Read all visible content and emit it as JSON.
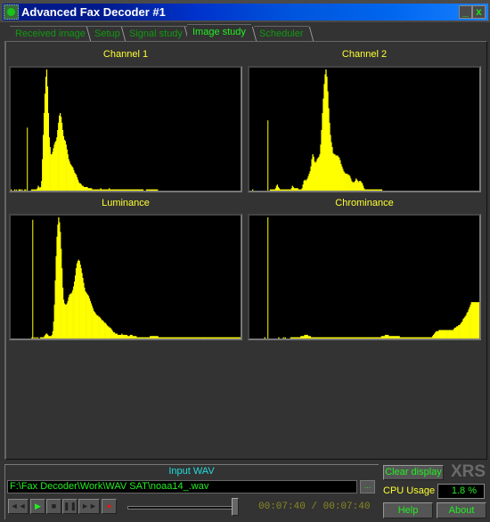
{
  "window": {
    "title": "Advanced Fax Decoder #1",
    "minimize_glyph": "_",
    "close_glyph": "x"
  },
  "tabs": [
    {
      "label": "Received image",
      "active": false
    },
    {
      "label": "Setup",
      "active": false
    },
    {
      "label": "Signal study",
      "active": false
    },
    {
      "label": "Image study",
      "active": true
    },
    {
      "label": "Scheduler",
      "active": false
    }
  ],
  "colors": {
    "histogram": "#ffff00",
    "accent_green": "#22ee22",
    "label_yellow": "#ffff33",
    "label_cyan": "#22dddd"
  },
  "chart_data": [
    {
      "type": "bar",
      "title": "Channel 1",
      "xlabel": "",
      "ylabel": "",
      "xlim": [
        0,
        255
      ],
      "ylim": [
        0,
        100
      ],
      "grid": false,
      "marker_line": {
        "x": 18,
        "value": 52
      },
      "values": [
        1,
        0,
        0,
        0,
        1,
        0,
        1,
        0,
        0,
        1,
        1,
        1,
        0,
        1,
        0,
        0,
        1,
        1,
        0,
        0,
        0,
        0,
        0,
        0,
        1,
        1,
        1,
        1,
        1,
        1,
        1,
        2,
        4,
        3,
        2,
        3,
        8,
        26,
        46,
        64,
        80,
        94,
        100,
        86,
        64,
        44,
        36,
        30,
        30,
        32,
        35,
        38,
        40,
        41,
        44,
        50,
        56,
        62,
        64,
        61,
        56,
        50,
        45,
        42,
        41,
        38,
        34,
        30,
        26,
        24,
        22,
        21,
        20,
        19,
        17,
        15,
        14,
        13,
        11,
        9,
        7,
        6,
        6,
        5,
        4,
        4,
        3,
        3,
        3,
        3,
        3,
        2,
        2,
        2,
        2,
        2,
        1,
        1,
        1,
        1,
        1,
        1,
        1,
        1,
        1,
        1,
        2,
        1,
        1,
        1,
        1,
        1,
        1,
        1,
        1,
        1,
        2,
        1,
        1,
        1,
        1,
        1,
        1,
        1,
        1,
        1,
        1,
        1,
        1,
        1,
        1,
        1,
        1,
        1,
        1,
        1,
        1,
        1,
        1,
        1,
        1,
        1,
        1,
        1,
        1,
        1,
        1,
        1,
        1,
        1,
        1,
        1,
        1,
        1,
        1,
        1,
        1,
        0,
        0,
        0,
        1,
        1,
        1,
        1,
        1,
        1,
        1,
        1,
        1,
        1,
        1,
        1,
        1,
        1,
        0,
        0,
        0,
        0,
        0,
        0,
        0,
        0,
        0,
        0,
        0,
        0,
        0,
        0,
        0,
        0,
        0,
        0,
        0,
        0,
        0,
        0,
        0,
        0,
        0,
        0,
        0,
        0,
        0,
        0,
        0,
        0,
        0,
        0,
        0,
        0,
        0,
        0,
        0,
        0,
        0,
        0,
        0,
        0,
        0,
        0,
        0,
        0,
        0,
        0,
        0,
        0,
        0,
        0,
        0,
        0,
        0,
        0,
        0,
        0,
        0,
        0,
        0,
        0,
        0,
        0,
        0,
        0,
        0,
        0,
        0,
        0,
        0,
        0,
        0,
        0,
        0,
        0,
        0,
        0,
        0,
        0,
        0,
        0,
        0,
        0,
        0,
        0,
        0,
        0,
        0,
        0,
        0,
        0,
        0,
        0,
        0,
        0
      ]
    },
    {
      "type": "bar",
      "title": "Channel 2",
      "xlabel": "",
      "ylabel": "",
      "xlim": [
        0,
        255
      ],
      "ylim": [
        0,
        100
      ],
      "grid": false,
      "marker_line": {
        "x": 20,
        "value": 58
      },
      "values": [
        0,
        0,
        0,
        1,
        0,
        0,
        0,
        0,
        0,
        0,
        0,
        0,
        0,
        0,
        0,
        0,
        0,
        0,
        0,
        0,
        0,
        0,
        0,
        1,
        1,
        1,
        1,
        1,
        1,
        2,
        4,
        5,
        3,
        2,
        1,
        1,
        1,
        1,
        1,
        1,
        1,
        1,
        1,
        1,
        1,
        1,
        1,
        2,
        4,
        3,
        2,
        2,
        2,
        2,
        2,
        1,
        1,
        1,
        1,
        2,
        5,
        8,
        9,
        8,
        9,
        10,
        12,
        14,
        16,
        20,
        26,
        30,
        28,
        24,
        23,
        24,
        26,
        27,
        28,
        30,
        38,
        50,
        64,
        76,
        88,
        96,
        100,
        94,
        82,
        68,
        56,
        46,
        40,
        36,
        31,
        30,
        30,
        29,
        29,
        29,
        28,
        27,
        25,
        22,
        20,
        18,
        16,
        15,
        14,
        14,
        14,
        13,
        13,
        12,
        10,
        8,
        7,
        7,
        7,
        8,
        10,
        9,
        8,
        7,
        8,
        8,
        7,
        6,
        4,
        2,
        1,
        1,
        1,
        1,
        1,
        1,
        1,
        1,
        1,
        1,
        1,
        1,
        1,
        1,
        1,
        1,
        1,
        1,
        1,
        1,
        0,
        0,
        0,
        0,
        0,
        0,
        0,
        0,
        0,
        0,
        0,
        0,
        0,
        0,
        0,
        0,
        0,
        0,
        0,
        0,
        0,
        0,
        0,
        0,
        0,
        0,
        0,
        0,
        0,
        0,
        0,
        0,
        0,
        0,
        0,
        0,
        0,
        0,
        0,
        0,
        0,
        0,
        0,
        0,
        0,
        0,
        0,
        0,
        0,
        0,
        0,
        0,
        0,
        0,
        0,
        0,
        0,
        0,
        0,
        0,
        0,
        0,
        0,
        0,
        0,
        0,
        0,
        0,
        0,
        0,
        0,
        0,
        0,
        0,
        0,
        0,
        0,
        0,
        0,
        0,
        0,
        0,
        0,
        0,
        0,
        0,
        0,
        0,
        0,
        0,
        0,
        0,
        0,
        0,
        0,
        0,
        0,
        0,
        0,
        0,
        0,
        0,
        0,
        0,
        0,
        0,
        0,
        0,
        0,
        0
      ]
    },
    {
      "type": "bar",
      "title": "Luminance",
      "xlabel": "",
      "ylabel": "",
      "xlim": [
        0,
        255
      ],
      "ylim": [
        0,
        100
      ],
      "grid": false,
      "marker_line": {
        "x": 24,
        "value": 98
      },
      "values": [
        0,
        0,
        0,
        0,
        0,
        0,
        0,
        0,
        0,
        0,
        0,
        0,
        0,
        0,
        0,
        0,
        0,
        0,
        0,
        0,
        0,
        0,
        0,
        0,
        0,
        1,
        1,
        0,
        1,
        0,
        1,
        0,
        1,
        0,
        0,
        1,
        1,
        1,
        1,
        1,
        2,
        3,
        4,
        4,
        3,
        2,
        2,
        2,
        2,
        3,
        6,
        14,
        28,
        48,
        68,
        84,
        94,
        100,
        96,
        88,
        74,
        58,
        42,
        32,
        29,
        28,
        28,
        29,
        31,
        34,
        36,
        37,
        37,
        38,
        40,
        43,
        47,
        52,
        58,
        62,
        64,
        65,
        64,
        61,
        58,
        54,
        50,
        46,
        42,
        39,
        38,
        37,
        36,
        35,
        33,
        31,
        29,
        27,
        25,
        23,
        22,
        21,
        20,
        19,
        19,
        18,
        18,
        17,
        16,
        15,
        15,
        14,
        13,
        13,
        12,
        11,
        10,
        10,
        9,
        9,
        8,
        7,
        6,
        5,
        5,
        4,
        4,
        4,
        3,
        3,
        3,
        3,
        3,
        4,
        3,
        3,
        3,
        3,
        3,
        3,
        2,
        2,
        2,
        3,
        3,
        3,
        2,
        2,
        2,
        2,
        2,
        1,
        1,
        1,
        1,
        1,
        1,
        1,
        1,
        1,
        1,
        1,
        1,
        1,
        1,
        1,
        1,
        2,
        2,
        2,
        2,
        2,
        2,
        2,
        2,
        2,
        2,
        1,
        1,
        1,
        1,
        1,
        1,
        1,
        1,
        1,
        1,
        1,
        1,
        1,
        1,
        1,
        1,
        1,
        1,
        1,
        1,
        1,
        1,
        1,
        1,
        1,
        1,
        1,
        1,
        1,
        1,
        1,
        1,
        1,
        1,
        1,
        1,
        1,
        1,
        1,
        1,
        1,
        1,
        1,
        1,
        1,
        1,
        1,
        1,
        1,
        1,
        1,
        1,
        1,
        1,
        1,
        1,
        1,
        1,
        1,
        1,
        1,
        1,
        1,
        1,
        1,
        1,
        1,
        1,
        1,
        1,
        1,
        1,
        1,
        1,
        1,
        1,
        1,
        1,
        1,
        1,
        1,
        1,
        1,
        1,
        1,
        1,
        1,
        1,
        1,
        1,
        1,
        1,
        1,
        1,
        1,
        1,
        1,
        1,
        1
      ]
    },
    {
      "type": "bar",
      "title": "Chrominance",
      "xlabel": "",
      "ylabel": "",
      "xlim": [
        0,
        255
      ],
      "ylim": [
        0,
        100
      ],
      "grid": false,
      "marker_line": {
        "x": 20,
        "value": 100
      },
      "values": [
        0,
        0,
        0,
        0,
        0,
        0,
        0,
        0,
        0,
        0,
        0,
        0,
        0,
        0,
        0,
        0,
        1,
        0,
        0,
        0,
        0,
        0,
        0,
        0,
        0,
        0,
        0,
        0,
        0,
        0,
        0,
        1,
        0,
        0,
        0,
        0,
        1,
        0,
        1,
        0,
        0,
        0,
        0,
        0,
        1,
        1,
        1,
        1,
        1,
        1,
        1,
        1,
        1,
        1,
        1,
        2,
        2,
        2,
        2,
        3,
        3,
        3,
        3,
        2,
        2,
        2,
        1,
        1,
        1,
        1,
        1,
        1,
        1,
        1,
        1,
        1,
        1,
        1,
        1,
        1,
        1,
        1,
        1,
        1,
        1,
        1,
        1,
        1,
        1,
        1,
        1,
        1,
        1,
        1,
        1,
        1,
        1,
        1,
        1,
        1,
        1,
        1,
        1,
        1,
        1,
        1,
        1,
        1,
        1,
        1,
        1,
        1,
        1,
        1,
        1,
        1,
        1,
        1,
        1,
        1,
        1,
        1,
        1,
        1,
        1,
        1,
        1,
        1,
        1,
        1,
        1,
        1,
        1,
        1,
        1,
        1,
        1,
        1,
        1,
        1,
        1,
        1,
        2,
        2,
        2,
        2,
        3,
        3,
        3,
        3,
        2,
        2,
        2,
        2,
        2,
        2,
        2,
        2,
        2,
        2,
        2,
        2,
        1,
        1,
        1,
        1,
        1,
        1,
        1,
        1,
        1,
        1,
        1,
        1,
        1,
        1,
        1,
        1,
        1,
        1,
        1,
        1,
        1,
        1,
        1,
        1,
        1,
        1,
        1,
        1,
        1,
        1,
        1,
        1,
        1,
        1,
        1,
        2,
        3,
        4,
        5,
        6,
        6,
        6,
        7,
        7,
        7,
        7,
        7,
        7,
        7,
        7,
        7,
        7,
        7,
        7,
        7,
        7,
        7,
        7,
        8,
        9,
        9,
        10,
        10,
        11,
        11,
        12,
        13,
        14,
        16,
        17,
        18,
        19,
        21,
        22,
        24,
        26,
        28,
        30,
        30,
        30,
        30,
        30,
        30,
        30,
        30,
        30
      ]
    }
  ],
  "input": {
    "label": "Input WAV",
    "path": "F:\\Fax Decoder\\Work\\WAV SAT\\noaa14_.wav",
    "browse_label": "...",
    "elapsed": "00:07:40",
    "separator": "/",
    "total": "00:07:40",
    "position_fraction": 1.0
  },
  "transport": [
    {
      "name": "rewind-button",
      "icon": "rewind-icon",
      "glyph": "◄◄"
    },
    {
      "name": "play-button",
      "icon": "play-icon",
      "glyph": "▶"
    },
    {
      "name": "stop-button",
      "icon": "stop-icon",
      "glyph": "■"
    },
    {
      "name": "pause-button",
      "icon": "pause-icon",
      "glyph": "❚❚"
    },
    {
      "name": "fast-forward-button",
      "icon": "fast-forward-icon",
      "glyph": "►►"
    },
    {
      "name": "record-button",
      "icon": "record-icon",
      "glyph": "●"
    }
  ],
  "side": {
    "clear_display": "Clear display",
    "logo": "XRS",
    "cpu_label": "CPU Usage",
    "cpu_value": "1.8 %",
    "help": "Help",
    "about": "About"
  }
}
